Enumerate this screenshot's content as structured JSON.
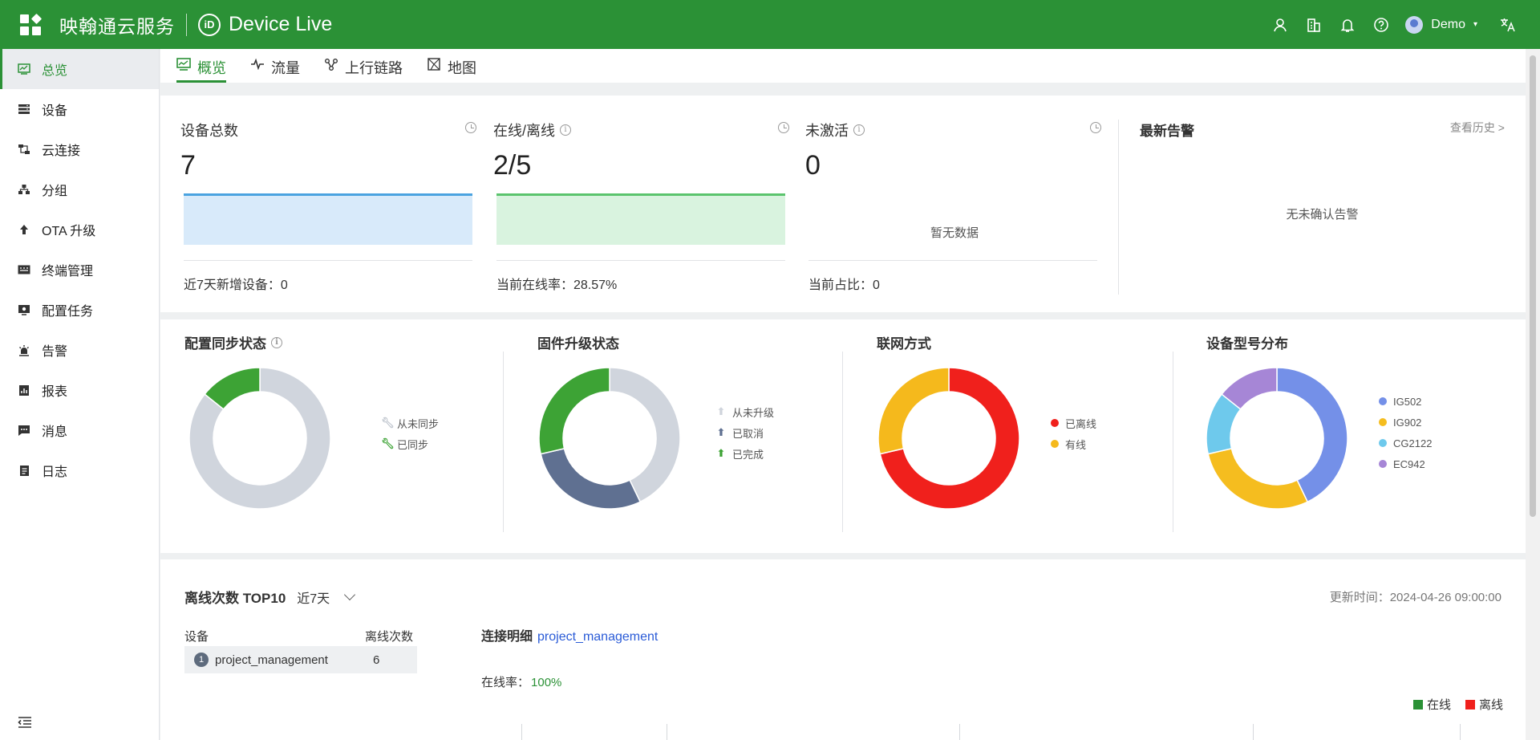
{
  "header": {
    "company": "映翰通云服务",
    "product": "Device Live",
    "logo_text": "iD",
    "user_name": "Demo"
  },
  "sidebar": {
    "items": [
      {
        "label": "总览",
        "icon": "overview-icon",
        "active": true
      },
      {
        "label": "设备",
        "icon": "device-icon"
      },
      {
        "label": "云连接",
        "icon": "cloud-connect-icon"
      },
      {
        "label": "分组",
        "icon": "group-icon"
      },
      {
        "label": "OTA 升级",
        "icon": "upgrade-icon"
      },
      {
        "label": "终端管理",
        "icon": "terminal-icon"
      },
      {
        "label": "配置任务",
        "icon": "config-task-icon"
      },
      {
        "label": "告警",
        "icon": "alarm-icon"
      },
      {
        "label": "报表",
        "icon": "report-icon"
      },
      {
        "label": "消息",
        "icon": "message-icon"
      },
      {
        "label": "日志",
        "icon": "log-icon"
      }
    ]
  },
  "tabs": [
    {
      "label": "概览",
      "icon": "overview-chart-icon",
      "active": true
    },
    {
      "label": "流量",
      "icon": "pulse-icon"
    },
    {
      "label": "上行链路",
      "icon": "uplink-icon"
    },
    {
      "label": "地图",
      "icon": "map-icon"
    }
  ],
  "stats": {
    "total": {
      "title": "设备总数",
      "value": "7",
      "footer": "近7天新增设备：0"
    },
    "online": {
      "title": "在线/离线",
      "value": "2/5",
      "footer": "当前在线率：28.57%"
    },
    "inactive": {
      "title": "未激活",
      "value": "0",
      "no_data": "暂无数据",
      "footer": "当前占比：0"
    },
    "alerts": {
      "title": "最新告警",
      "link": "查看历史 >",
      "empty": "无未确认告警"
    }
  },
  "colors": {
    "brand": "#2b9136",
    "blue_line": "#4aa3e0",
    "blue_fill": "#d8eafa",
    "green_line": "#5bc46d",
    "green_fill": "#d9f3df",
    "grey": "#d0d5dd",
    "green": "#3da335",
    "slate": "#5f7091",
    "red": "#f0201c",
    "yellow": "#f5b91c",
    "ig502": "#7490e8",
    "ig902": "#f5bd1f",
    "cg2122": "#6ec9ec",
    "ec942": "#a686d6"
  },
  "chart_data": [
    {
      "type": "pie",
      "title": "配置同步状态",
      "categories": [
        "从未同步",
        "已同步"
      ],
      "values": [
        6,
        1
      ]
    },
    {
      "type": "pie",
      "title": "固件升级状态",
      "categories": [
        "从未升级",
        "已取消",
        "已完成"
      ],
      "values": [
        3,
        2,
        2
      ]
    },
    {
      "type": "pie",
      "title": "联网方式",
      "categories": [
        "已离线",
        "有线"
      ],
      "values": [
        5,
        2
      ]
    },
    {
      "type": "pie",
      "title": "设备型号分布",
      "categories": [
        "IG502",
        "IG902",
        "CG2122",
        "EC942"
      ],
      "values": [
        3,
        2,
        1,
        1
      ]
    }
  ],
  "bottom": {
    "title": "离线次数 TOP10",
    "range": "近7天",
    "updated": "更新时间：2024-04-26 09:00:00",
    "table_headers": [
      "设备",
      "离线次数"
    ],
    "rows": [
      {
        "rank": "1",
        "device": "project_management",
        "count": "6"
      }
    ],
    "conn_label": "连接明细",
    "conn_device": "project_management",
    "online_rate_label": "在线率：",
    "online_rate_value": "100%",
    "legend": [
      "在线",
      "离线"
    ]
  }
}
